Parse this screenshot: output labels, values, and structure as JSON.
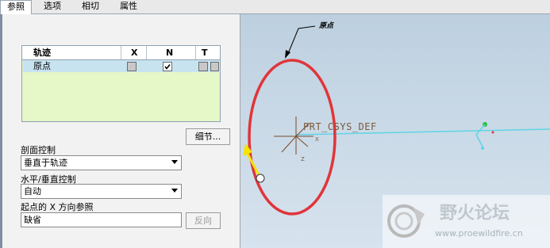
{
  "tabs": [
    {
      "label": "参照",
      "active": true
    },
    {
      "label": "选项",
      "active": false
    },
    {
      "label": "相切",
      "active": false
    },
    {
      "label": "属性",
      "active": false
    }
  ],
  "trajectory_table": {
    "headers": {
      "name": "轨迹",
      "x": "X",
      "n": "N",
      "t": "T"
    },
    "rows": [
      {
        "name": "原点",
        "x_checked": false,
        "n_checked": true,
        "t_checked": false
      }
    ]
  },
  "details_button": "细节...",
  "section_control": {
    "label": "剖面控制",
    "value": "垂直于轨迹"
  },
  "hv_control": {
    "label": "水平/垂直控制",
    "value": "自动"
  },
  "x_ref": {
    "label": "起点的 X 方向参照",
    "value": "缺省",
    "flip_button": "反向"
  },
  "viewport": {
    "origin_label": "原点",
    "csys_label": "PRT_CSYS_DEF",
    "axis_x": "X",
    "axis_z": "Z",
    "colors": {
      "trajectory": "#e0353a",
      "datum": "#5fd4e6",
      "arrow": "#f4e400"
    }
  },
  "watermark": {
    "title": "野火论坛",
    "url": "www.proewildfire.cn"
  }
}
